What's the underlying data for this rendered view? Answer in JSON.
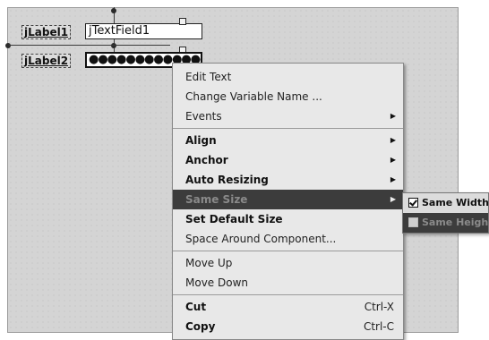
{
  "form": {
    "label1": "jLabel1",
    "label2": "jLabel2",
    "textfield1": "jTextField1",
    "password_value": "●●●●●●●●●●●●●"
  },
  "context_menu": {
    "items": [
      {
        "label": "Edit Text",
        "bold": false,
        "submenu": false
      },
      {
        "label": "Change Variable Name ...",
        "bold": false,
        "submenu": false
      },
      {
        "label": "Events",
        "bold": false,
        "submenu": true
      },
      {
        "label": "Align",
        "bold": true,
        "submenu": true
      },
      {
        "label": "Anchor",
        "bold": true,
        "submenu": true
      },
      {
        "label": "Auto Resizing",
        "bold": true,
        "submenu": true
      },
      {
        "label": "Same Size",
        "bold": true,
        "submenu": true,
        "highlighted": true
      },
      {
        "label": "Set Default Size",
        "bold": true,
        "submenu": false
      },
      {
        "label": "Space Around Component...",
        "bold": false,
        "submenu": false
      },
      {
        "label": "Move Up",
        "bold": false,
        "submenu": false
      },
      {
        "label": "Move Down",
        "bold": false,
        "submenu": false
      },
      {
        "label": "Cut",
        "bold": true,
        "submenu": false,
        "shortcut": "Ctrl-X"
      },
      {
        "label": "Copy",
        "bold": true,
        "submenu": false,
        "shortcut": "Ctrl-C"
      }
    ]
  },
  "same_size_submenu": {
    "same_width": "Same Width",
    "same_height": "Same Height",
    "same_width_checked": true,
    "same_height_checked": false
  },
  "colors": {
    "canvas": "#d4d4d4",
    "menu_bg": "#e8e8e8",
    "highlight": "#3c3c3c"
  }
}
